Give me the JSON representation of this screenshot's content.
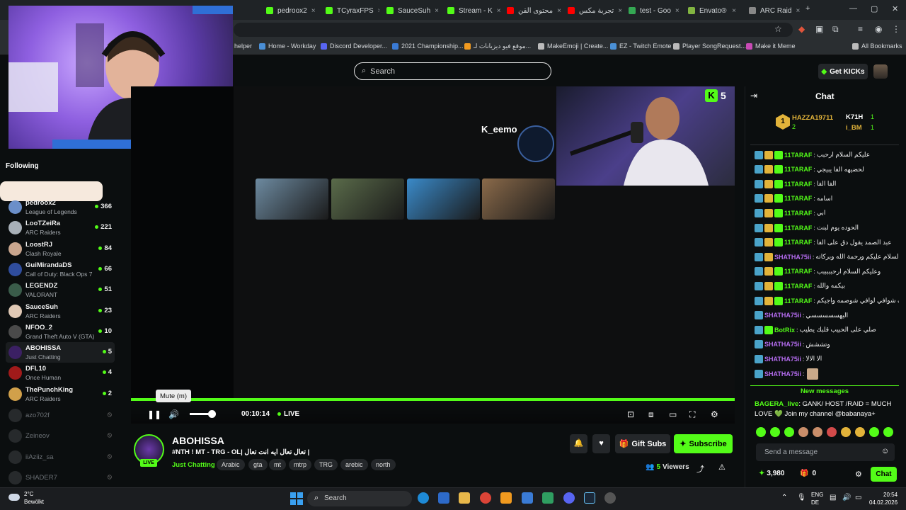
{
  "browser": {
    "tabs": [
      {
        "label": "pedroox2",
        "color": "#53fc18"
      },
      {
        "label": "TCyraxFPS",
        "color": "#53fc18"
      },
      {
        "label": "SauceSuh",
        "color": "#53fc18"
      },
      {
        "label": "Stream - K",
        "color": "#53fc18"
      },
      {
        "label": "محتوى القن",
        "color": "#ff0000"
      },
      {
        "label": "تجربة مكس",
        "color": "#ff0000"
      },
      {
        "label": "test - Goo",
        "color": "#34a853"
      },
      {
        "label": "Envato®",
        "color": "#82b541"
      },
      {
        "label": "ARC Raid",
        "color": "#888888"
      }
    ],
    "bookmarks": [
      "helper",
      "Home - Workday",
      "Discord Developer...",
      "2021 Championship...",
      "موقع فيو ديزيانات لـ...",
      "MakeEmoji | Create...",
      "EZ - Twitch Emote",
      "Player SongRequest...",
      "Make it Meme",
      "All Bookmarks"
    ]
  },
  "header": {
    "search_placeholder": "Search",
    "get_kicks": "Get KICKs"
  },
  "sidebar": {
    "followed_label": "Following",
    "items": [
      {
        "name": "pedroox2",
        "category": "League of Legends",
        "count": "366",
        "color": "#6b8fc9"
      },
      {
        "name": "LooTZeiRa",
        "category": "ARC Raiders",
        "count": "221",
        "color": "#a8b0b8"
      },
      {
        "name": "LoostRJ",
        "category": "Clash Royale",
        "count": "84",
        "color": "#c9a68e"
      },
      {
        "name": "GuiMirandaDS",
        "category": "Call of Duty: Black Ops 7",
        "count": "66",
        "color": "#2f4d9e"
      },
      {
        "name": "LEGENDZ",
        "category": "VALORANT",
        "count": "51",
        "color": "#3a5c4a"
      },
      {
        "name": "SauceSuh",
        "category": "ARC Raiders",
        "count": "23",
        "color": "#e0c9b5"
      },
      {
        "name": "NFOO_2",
        "category": "Grand Theft Auto V (GTA)",
        "count": "10",
        "color": "#4a4a4a"
      },
      {
        "name": "ABOHISSA",
        "category": "Just Chatting",
        "count": "5",
        "color": "#3b2063"
      },
      {
        "name": "DFL10",
        "category": "Once Human",
        "count": "4",
        "color": "#a01a1a"
      },
      {
        "name": "ThePunchKing",
        "category": "ARC Raiders",
        "count": "2",
        "color": "#d1a04a"
      }
    ],
    "offline": [
      "azo702f",
      "Zeineov",
      "iiAziiz_sa",
      "SHADER7"
    ]
  },
  "video": {
    "yt_channel": "K_eemo",
    "mute_tooltip": "Mute (m)",
    "time": "00:10:14",
    "live_label": "LIVE",
    "thumb_colors": [
      "#6d8aa0",
      "#5a6b4a",
      "#3a8ac9",
      "#8a6a4a"
    ]
  },
  "stream": {
    "name": "ABOHISSA",
    "title": "#NTH ! MT - TRG - OL| تعال تعال ايه انت تعال |",
    "category": "Just Chatting",
    "tags": [
      "Arabic",
      "gta",
      "mt",
      "mtrp",
      "TRG",
      "arebic",
      "north"
    ],
    "live_tag": "LIVE",
    "gift_subs": "Gift Subs",
    "subscribe": "Subscribe",
    "viewers_count": "5",
    "viewers_label": "Viewers"
  },
  "chat": {
    "title": "Chat",
    "leaderboard": [
      {
        "name": "HAZZA19711",
        "value": "2",
        "rank": "1"
      },
      {
        "name": "K71H",
        "value": "1"
      },
      {
        "name": "i_BM",
        "value": "1"
      }
    ],
    "messages": [
      {
        "user": "11TARAF",
        "color": "#53fc18",
        "text": "عليكم السلام ارحبب",
        "badges": [
          "blue",
          "gold",
          "green"
        ]
      },
      {
        "user": "11TARAF",
        "color": "#53fc18",
        "text": "لحضيهه الفا يبيجي",
        "badges": [
          "blue",
          "gold",
          "green"
        ]
      },
      {
        "user": "11TARAF",
        "color": "#53fc18",
        "text": "الفا الفا",
        "badges": [
          "blue",
          "gold",
          "green"
        ]
      },
      {
        "user": "11TARAF",
        "color": "#53fc18",
        "text": "اسامه",
        "badges": [
          "blue",
          "gold",
          "green"
        ]
      },
      {
        "user": "11TARAF",
        "color": "#53fc18",
        "text": "ابي",
        "badges": [
          "blue",
          "gold",
          "green"
        ]
      },
      {
        "user": "11TARAF",
        "color": "#53fc18",
        "text": "الحوده يوم لبنت",
        "badges": [
          "blue",
          "gold",
          "green"
        ]
      },
      {
        "user": "11TARAF",
        "color": "#53fc18",
        "text": "عبد الصمد يقول دق على الفا",
        "badges": [
          "blue",
          "gold",
          "green"
        ]
      },
      {
        "user": "SHATHA75ii",
        "color": "#b56cf0",
        "text": "السلام عليكم ورحمة الله وبركاته",
        "badges": [
          "blue",
          "gold"
        ]
      },
      {
        "user": "11TARAF",
        "color": "#53fc18",
        "text": "وعليكم السلام ارحبببببب",
        "badges": [
          "blue",
          "gold",
          "green"
        ]
      },
      {
        "user": "11TARAF",
        "color": "#53fc18",
        "text": "بيكمه والله",
        "badges": [
          "blue",
          "gold",
          "green"
        ]
      },
      {
        "user": "11TARAF",
        "color": "#53fc18",
        "text": "اشوف شوافي لوافي شوصمه واجيكم",
        "badges": [
          "blue",
          "gold",
          "green"
        ]
      },
      {
        "user": "SHATHA75ii",
        "color": "#b56cf0",
        "text": "اليهسسسسسي",
        "badges": [
          "blue"
        ]
      },
      {
        "user": "BotRix",
        "color": "#53fc18",
        "text": "صلي على الحبيب قلبك يطيب",
        "badges": [
          "blue",
          "green"
        ]
      },
      {
        "user": "SHATHA75ii",
        "color": "#b56cf0",
        "text": "وتششش",
        "badges": [
          "blue"
        ]
      },
      {
        "user": "SHATHA75ii",
        "color": "#b56cf0",
        "text": "الا الالا",
        "badges": [
          "blue"
        ]
      },
      {
        "user": "SHATHA75ii",
        "color": "#b56cf0",
        "text": "",
        "badges": [
          "blue"
        ]
      }
    ],
    "new_messages": "New messages",
    "pinned_user": "BAGERA_live",
    "pinned_text": "GANK/ HOST /RAID = MUCH LOVE 💚 Join my channel @babanaya+",
    "input_placeholder": "Send a message",
    "points": "3,980",
    "gift_count": "0",
    "send_label": "Chat"
  },
  "taskbar": {
    "temp": "2°C",
    "weather": "Bewölkt",
    "search": "Search",
    "lang1": "ENG",
    "lang2": "DE",
    "time": "20:54",
    "date": "04.02.2026"
  },
  "colors": {
    "accent": "#53fc18",
    "bg": "#0b0e0f"
  }
}
